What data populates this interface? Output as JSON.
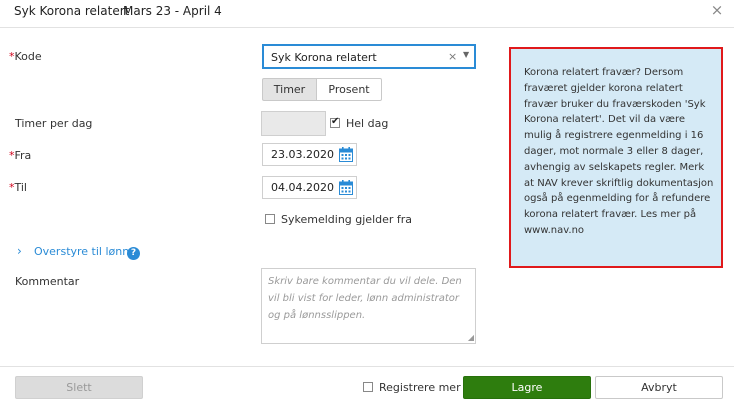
{
  "header": {
    "title": "Syk Korona relatert",
    "date_range": "Mars 23 - April 4",
    "close_symbol": "×"
  },
  "form": {
    "kode": {
      "required_mark": "*",
      "label": "Kode",
      "value": "Syk Korona relatert",
      "clear_symbol": "×",
      "arrow_symbol": "▼"
    },
    "unit_toggle": {
      "options": [
        "Timer",
        "Prosent"
      ],
      "selected": "Timer"
    },
    "timer_per_dag": {
      "label": "Timer per dag",
      "value": "",
      "hel_dag_label": "Hel dag",
      "hel_dag_checked": true
    },
    "fra": {
      "required_mark": "*",
      "label": "Fra",
      "value": "23.03.2020"
    },
    "til": {
      "required_mark": "*",
      "label": "Til",
      "value": "04.04.2020"
    },
    "sykemelding": {
      "label": "Sykemelding gjelder fra",
      "checked": false
    },
    "overstyre": {
      "label": "Overstyre til lønn",
      "help_symbol": "?"
    },
    "kommentar": {
      "label": "Kommentar",
      "placeholder": "Skriv bare kommentar du vil dele. Den vil bli vist for leder, lønn administrator og på lønnsslippen."
    }
  },
  "info_box": {
    "text": "Korona relatert fravær? Dersom fraværet gjelder korona relatert fravær bruker du fraværskoden 'Syk Korona relatert'. Det vil da være mulig å registrere egenmelding i 16 dager, mot normale 3 eller 8 dager, avhengig av selskapets regler. Merk at NAV krever skriftlig dokumentasjon også på egenmelding for å refundere korona relatert fravær. Les mer på www.nav.no"
  },
  "footer": {
    "slett_label": "Slett",
    "registrere_mer_label": "Registrere mer",
    "registrere_mer_checked": false,
    "lagre_label": "Lagre",
    "avbryt_label": "Avbryt"
  },
  "colors": {
    "accent": "#2a8bd6",
    "primary_button": "#2e7d0e",
    "required": "#d0021b",
    "info_bg": "#d5eaf6",
    "info_border": "#e0191b"
  },
  "icons": [
    "close-icon",
    "clear-icon",
    "dropdown-arrow-icon",
    "checkmark-icon",
    "calendar-icon",
    "chevron-right-icon",
    "help-icon",
    "resize-grip-icon"
  ]
}
